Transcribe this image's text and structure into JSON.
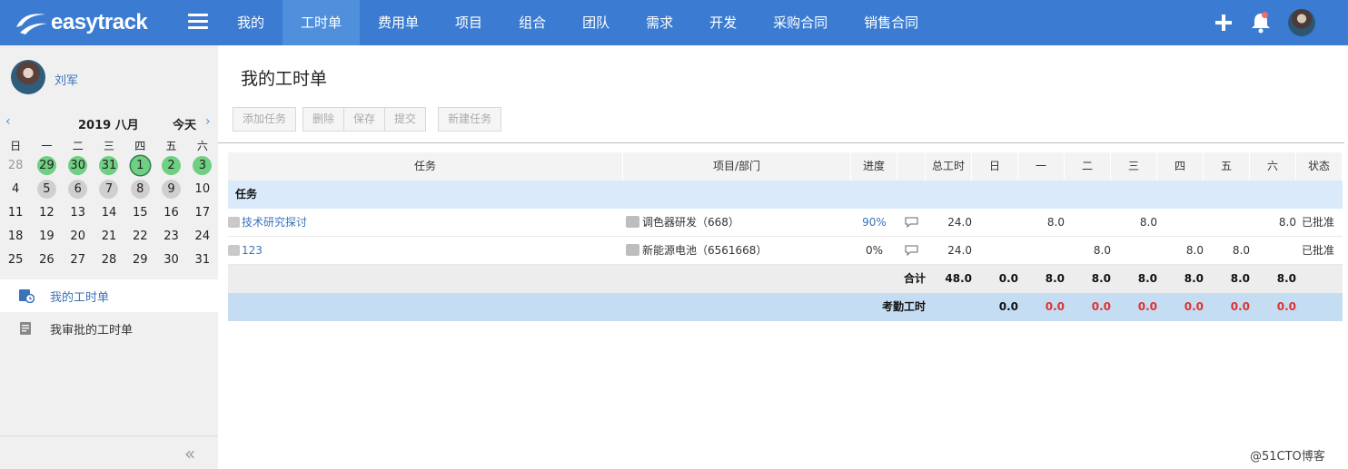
{
  "app": {
    "logo_text": "easytrack"
  },
  "nav": {
    "items": [
      "我的",
      "工时单",
      "费用单",
      "项目",
      "组合",
      "团队",
      "需求",
      "开发",
      "采购合同",
      "销售合同"
    ],
    "active_index": 1
  },
  "user": {
    "name": "刘军"
  },
  "calendar": {
    "title": "2019 八月",
    "today_label": "今天",
    "weekdays": [
      "日",
      "一",
      "二",
      "三",
      "四",
      "五",
      "六"
    ],
    "rows": [
      [
        {
          "d": "28",
          "s": "muted"
        },
        {
          "d": "29",
          "s": "green"
        },
        {
          "d": "30",
          "s": "green"
        },
        {
          "d": "31",
          "s": "green"
        },
        {
          "d": "1",
          "s": "green today"
        },
        {
          "d": "2",
          "s": "green"
        },
        {
          "d": "3",
          "s": "green"
        }
      ],
      [
        {
          "d": "4",
          "s": ""
        },
        {
          "d": "5",
          "s": "gray"
        },
        {
          "d": "6",
          "s": "gray"
        },
        {
          "d": "7",
          "s": "gray"
        },
        {
          "d": "8",
          "s": "gray"
        },
        {
          "d": "9",
          "s": "gray"
        },
        {
          "d": "10",
          "s": ""
        }
      ],
      [
        {
          "d": "11",
          "s": ""
        },
        {
          "d": "12",
          "s": ""
        },
        {
          "d": "13",
          "s": ""
        },
        {
          "d": "14",
          "s": ""
        },
        {
          "d": "15",
          "s": ""
        },
        {
          "d": "16",
          "s": ""
        },
        {
          "d": "17",
          "s": ""
        }
      ],
      [
        {
          "d": "18",
          "s": ""
        },
        {
          "d": "19",
          "s": ""
        },
        {
          "d": "20",
          "s": ""
        },
        {
          "d": "21",
          "s": ""
        },
        {
          "d": "22",
          "s": ""
        },
        {
          "d": "23",
          "s": ""
        },
        {
          "d": "24",
          "s": ""
        }
      ],
      [
        {
          "d": "25",
          "s": ""
        },
        {
          "d": "26",
          "s": ""
        },
        {
          "d": "27",
          "s": ""
        },
        {
          "d": "28",
          "s": ""
        },
        {
          "d": "29",
          "s": ""
        },
        {
          "d": "30",
          "s": ""
        },
        {
          "d": "31",
          "s": ""
        }
      ]
    ]
  },
  "side_menu": {
    "my_timesheet": "我的工时单",
    "approve_timesheet": "我审批的工时单"
  },
  "page": {
    "title": "我的工时单"
  },
  "toolbar": {
    "add_task": "添加任务",
    "delete": "删除",
    "save": "保存",
    "submit": "提交",
    "new_task": "新建任务"
  },
  "table": {
    "headers": {
      "task": "任务",
      "project": "项目/部门",
      "progress": "进度",
      "total": "总工时",
      "sun": "日",
      "mon": "一",
      "tue": "二",
      "wed": "三",
      "thu": "四",
      "fri": "五",
      "sat": "六",
      "status": "状态"
    },
    "group_label": "任务",
    "rows": [
      {
        "task": "技术研究探讨",
        "project": "调色器研发（668）",
        "progress": "90%",
        "total": "24.0",
        "sun": "",
        "mon": "8.0",
        "tue": "",
        "wed": "8.0",
        "thu": "",
        "fri": "",
        "sat": "8.0",
        "status": "已批准"
      },
      {
        "task": "123",
        "project": "新能源电池（6561668）",
        "progress": "0%",
        "total": "24.0",
        "sun": "",
        "mon": "",
        "tue": "8.0",
        "wed": "",
        "thu": "8.0",
        "fri": "8.0",
        "sat": "",
        "status": "已批准"
      }
    ],
    "totals": {
      "label": "合计",
      "total": "48.0",
      "sun": "0.0",
      "mon": "8.0",
      "tue": "8.0",
      "wed": "8.0",
      "thu": "8.0",
      "fri": "8.0",
      "sat": "8.0"
    },
    "attendance": {
      "label": "考勤工时",
      "sun": "0.0",
      "mon": "0.0",
      "tue": "0.0",
      "wed": "0.0",
      "thu": "0.0",
      "fri": "0.0",
      "sat": "0.0"
    }
  },
  "colors": {
    "nav_bg": "#3b7cd2",
    "accent": "#3b73b9",
    "calendar_green": "#6fcf83",
    "alert_red": "#e03131"
  },
  "watermark": "@51CTO博客"
}
